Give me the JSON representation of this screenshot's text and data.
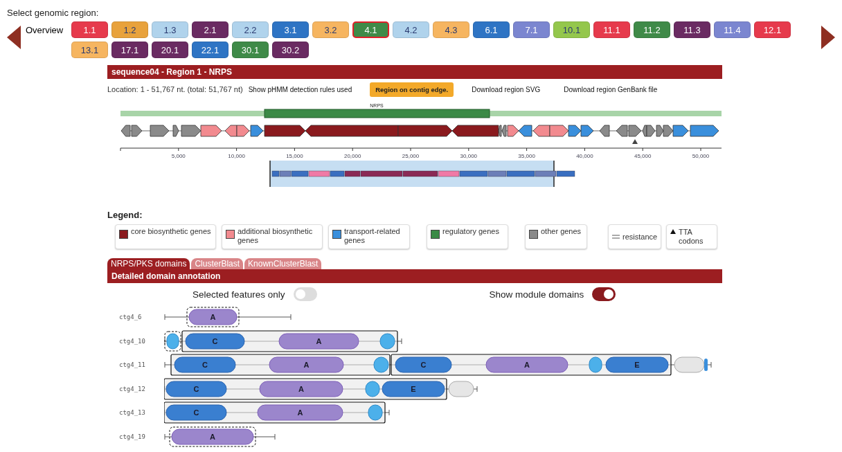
{
  "region_selector": {
    "label": "Select genomic region:",
    "overview": "Overview",
    "regions": [
      {
        "label": "1.1",
        "color": "#e63a4c",
        "selected": false
      },
      {
        "label": "1.2",
        "color": "#e8a23c",
        "selected": false
      },
      {
        "label": "1.3",
        "color": "#b0d3ec",
        "selected": false
      },
      {
        "label": "2.1",
        "color": "#6a2b62",
        "selected": false
      },
      {
        "label": "2.2",
        "color": "#b0d3ec",
        "selected": false
      },
      {
        "label": "3.1",
        "color": "#2e74c4",
        "selected": false
      },
      {
        "label": "3.2",
        "color": "#f6b560",
        "selected": false
      },
      {
        "label": "4.1",
        "color": "#3f8a48",
        "selected": true
      },
      {
        "label": "4.2",
        "color": "#b0d3ec",
        "selected": false
      },
      {
        "label": "4.3",
        "color": "#f6b560",
        "selected": false
      },
      {
        "label": "6.1",
        "color": "#2e74c4",
        "selected": false
      },
      {
        "label": "7.1",
        "color": "#7b86d0",
        "selected": false
      },
      {
        "label": "10.1",
        "color": "#94c74c",
        "selected": false
      },
      {
        "label": "11.1",
        "color": "#e63a4c",
        "selected": false
      },
      {
        "label": "11.2",
        "color": "#3f8a48",
        "selected": false
      },
      {
        "label": "11.3",
        "color": "#6a2b62",
        "selected": false
      },
      {
        "label": "11.4",
        "color": "#7b86d0",
        "selected": false
      },
      {
        "label": "12.1",
        "color": "#e63a4c",
        "selected": false
      },
      {
        "label": "13.1",
        "color": "#f6b560",
        "selected": false
      },
      {
        "label": "17.1",
        "color": "#6a2b62",
        "selected": false
      },
      {
        "label": "20.1",
        "color": "#6a2b62",
        "selected": false
      },
      {
        "label": "22.1",
        "color": "#2e74c4",
        "selected": false
      },
      {
        "label": "30.1",
        "color": "#3f8a48",
        "selected": false
      },
      {
        "label": "30.2",
        "color": "#6a2b62",
        "selected": false
      }
    ]
  },
  "region": {
    "title": "sequence04 - Region 1 - NRPS",
    "location": "Location: 1 - 51,767 nt. (total: 51,767 nt)",
    "rules_link": "Show pHMM detection rules used",
    "edge_badge": "Region on contig edge.",
    "download_svg": "Download region SVG",
    "download_genbank": "Download region GenBank file",
    "protocluster_label": "NRPS",
    "axis_ticks": [
      "5,000",
      "10,000",
      "15,000",
      "20,000",
      "25,000",
      "30,000",
      "35,000",
      "40,000",
      "45,000",
      "50,000"
    ]
  },
  "legend": {
    "title": "Legend:",
    "items": [
      {
        "label": "core biosynthetic genes",
        "kind": "swatch",
        "color": "#8a1a1e"
      },
      {
        "label": "additional biosynthetic genes",
        "kind": "swatch",
        "color": "#f28a8f"
      },
      {
        "label": "transport-related genes",
        "kind": "swatch",
        "color": "#3a8fdc"
      },
      {
        "label": "regulatory genes",
        "kind": "swatch",
        "color": "#3b8a46"
      },
      {
        "label": "other genes",
        "kind": "swatch",
        "color": "#8a8a8a"
      },
      {
        "label": "resistance",
        "kind": "resistance"
      },
      {
        "label": "TTA codons",
        "kind": "tta"
      }
    ]
  },
  "tabs": [
    {
      "label": "NRPS/PKS domains",
      "selected": true
    },
    {
      "label": "ClusterBlast",
      "selected": false
    },
    {
      "label": "KnownClusterBlast",
      "selected": false
    }
  ],
  "domains_panel": {
    "title": "Detailed domain annotation",
    "toggles": [
      {
        "label": "Selected features only",
        "on": false
      },
      {
        "label": "Show module domains",
        "on": true
      }
    ],
    "rows": [
      {
        "name": "ctg4_6",
        "domains": [
          {
            "label": "A",
            "kind": "adenylation"
          }
        ]
      },
      {
        "name": "ctg4_10",
        "domains": [
          {
            "label": "C",
            "kind": "condensation"
          },
          {
            "label": "A",
            "kind": "adenylation"
          }
        ]
      },
      {
        "name": "ctg4_11",
        "domains": [
          {
            "label": "C",
            "kind": "condensation"
          },
          {
            "label": "A",
            "kind": "adenylation"
          },
          {
            "label": "C",
            "kind": "condensation"
          },
          {
            "label": "A",
            "kind": "adenylation"
          },
          {
            "label": "E",
            "kind": "epimerization"
          }
        ]
      },
      {
        "name": "ctg4_12",
        "domains": [
          {
            "label": "C",
            "kind": "condensation"
          },
          {
            "label": "A",
            "kind": "adenylation"
          },
          {
            "label": "E",
            "kind": "epimerization"
          }
        ]
      },
      {
        "name": "ctg4_13",
        "domains": [
          {
            "label": "C",
            "kind": "condensation"
          },
          {
            "label": "A",
            "kind": "adenylation"
          }
        ]
      },
      {
        "name": "ctg4_19",
        "domains": [
          {
            "label": "A",
            "kind": "adenylation"
          }
        ]
      }
    ]
  }
}
